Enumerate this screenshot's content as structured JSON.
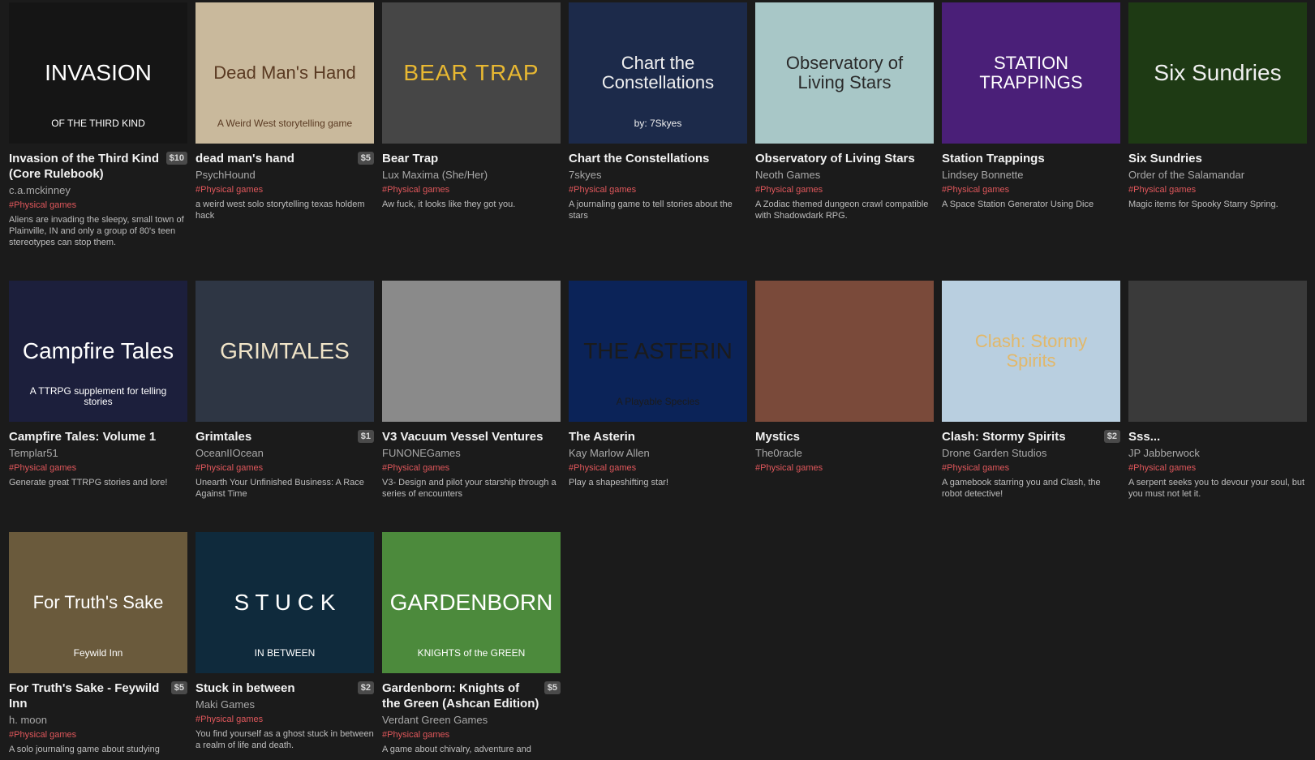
{
  "games": [
    {
      "title": "Invasion of the Third Kind (Core Rulebook)",
      "price": "$10",
      "author": "c.a.mckinney",
      "tag": "#Physical games",
      "desc": "Aliens are invading the sleepy, small town of Plainville, IN and only a group of 80's teen stereotypes can stop them.",
      "cover_text": "INVASION",
      "cover_sub": "OF THE THIRD KIND",
      "cover_bg": "#151515",
      "cover_fg": "#ffffff"
    },
    {
      "title": "dead man's hand",
      "price": "$5",
      "author": "PsychHound",
      "tag": "#Physical games",
      "desc": "a weird west solo storytelling texas holdem hack",
      "cover_text": "Dead Man's Hand",
      "cover_sub": "A Weird West storytelling game",
      "cover_bg": "#c9b99c",
      "cover_fg": "#5a3a22"
    },
    {
      "title": "Bear Trap",
      "price": "",
      "author": "Lux Maxima (She/Her)",
      "tag": "#Physical games",
      "desc": "Aw fuck, it looks like they got you.",
      "cover_text": "BEAR TRAP",
      "cover_sub": "",
      "cover_bg": "#464646",
      "cover_fg": "#e8b832"
    },
    {
      "title": "Chart the Constellations",
      "price": "",
      "author": "7skyes",
      "tag": "#Physical games",
      "desc": "A journaling game to tell stories about the stars",
      "cover_text": "Chart the Constellations",
      "cover_sub": "by: 7Skyes",
      "cover_bg": "#1c2a4a",
      "cover_fg": "#f0f0f0"
    },
    {
      "title": "Observatory of Living Stars",
      "price": "",
      "author": "Neoth Games",
      "tag": "#Physical games",
      "desc": "A Zodiac themed dungeon crawl compatible with Shadowdark RPG.",
      "cover_text": "Observatory of Living Stars",
      "cover_sub": "",
      "cover_bg": "#a8c7c7",
      "cover_fg": "#2a2a2a"
    },
    {
      "title": "Station Trappings",
      "price": "",
      "author": "Lindsey Bonnette",
      "tag": "#Physical games",
      "desc": "A Space Station Generator Using Dice",
      "cover_text": "STATION TRAPPINGS",
      "cover_sub": "",
      "cover_bg": "#4a1f78",
      "cover_fg": "#ffffff"
    },
    {
      "title": "Six Sundries",
      "price": "",
      "author": "Order of the Salamandar",
      "tag": "#Physical games",
      "desc": "Magic items for Spooky Starry Spring.",
      "cover_text": "Six Sundries",
      "cover_sub": "",
      "cover_bg": "#1e3a14",
      "cover_fg": "#f0f0f0"
    },
    {
      "title": "Campfire Tales: Volume 1",
      "price": "",
      "author": "Templar51",
      "tag": "#Physical games",
      "desc": "Generate great TTRPG stories and lore!",
      "cover_text": "Campfire Tales",
      "cover_sub": "A TTRPG supplement for telling stories",
      "cover_bg": "#1c1f3c",
      "cover_fg": "#ffffff"
    },
    {
      "title": "Grimtales",
      "price": "$1",
      "author": "OceanIIOcean",
      "tag": "#Physical games",
      "desc": "Unearth Your Unfinished Business: A Race Against Time",
      "cover_text": "GRIMTALES",
      "cover_sub": "",
      "cover_bg": "#2e3644",
      "cover_fg": "#f0e4c8"
    },
    {
      "title": "V3 Vacuum Vessel Ventures",
      "price": "",
      "author": "FUNONEGames",
      "tag": "#Physical games",
      "desc": "V3- Design and pilot your starship through a series of encounters",
      "cover_text": "",
      "cover_sub": "",
      "cover_bg": "#8a8a8a",
      "cover_fg": "#ffffff"
    },
    {
      "title": "The Asterin",
      "price": "",
      "author": "Kay Marlow Allen",
      "tag": "#Physical games",
      "desc": "Play a shapeshifting star!",
      "cover_text": "THE ASTERIN",
      "cover_sub": "A Playable Species",
      "cover_bg": "#0b2358",
      "cover_fg": "#1b1b1b"
    },
    {
      "title": "Mystics",
      "price": "",
      "author": "The0racle",
      "tag": "#Physical games",
      "desc": "",
      "cover_text": "",
      "cover_sub": "",
      "cover_bg": "#7a4a3a",
      "cover_fg": "#ffffff"
    },
    {
      "title": "Clash: Stormy Spirits",
      "price": "$2",
      "author": "Drone Garden Studios",
      "tag": "#Physical games",
      "desc": "A gamebook starring you and Clash, the robot detective!",
      "cover_text": "Clash: Stormy Spirits",
      "cover_sub": "",
      "cover_bg": "#b9cfe0",
      "cover_fg": "#e2b86a"
    },
    {
      "title": "Sss...",
      "price": "",
      "author": "JP Jabberwock",
      "tag": "#Physical games",
      "desc": "A serpent seeks you to devour your soul, but you must not let it.",
      "cover_text": "",
      "cover_sub": "",
      "cover_bg": "#3a3a3a",
      "cover_fg": "#111111"
    },
    {
      "title": "For Truth's Sake - Feywild Inn",
      "price": "$5",
      "author": "h. moon",
      "tag": "#Physical games",
      "desc": "A solo journaling game about studying",
      "cover_text": "For Truth's Sake",
      "cover_sub": "Feywild Inn",
      "cover_bg": "#6a5a3c",
      "cover_fg": "#ffffff"
    },
    {
      "title": "Stuck in between",
      "price": "$2",
      "author": "Maki Games",
      "tag": "#Physical games",
      "desc": "You find yourself as a ghost stuck in between a realm of life and death.",
      "cover_text": "S T U C K",
      "cover_sub": "IN BETWEEN",
      "cover_bg": "#0f2a3c",
      "cover_fg": "#ffffff"
    },
    {
      "title": "Gardenborn: Knights of the Green (Ashcan Edition)",
      "price": "$5",
      "author": "Verdant Green Games",
      "tag": "#Physical games",
      "desc": "A game about chivalry, adventure and",
      "cover_text": "GARDENBORN",
      "cover_sub": "KNIGHTS of the GREEN",
      "cover_bg": "#4c8a3c",
      "cover_fg": "#ffffff"
    }
  ]
}
